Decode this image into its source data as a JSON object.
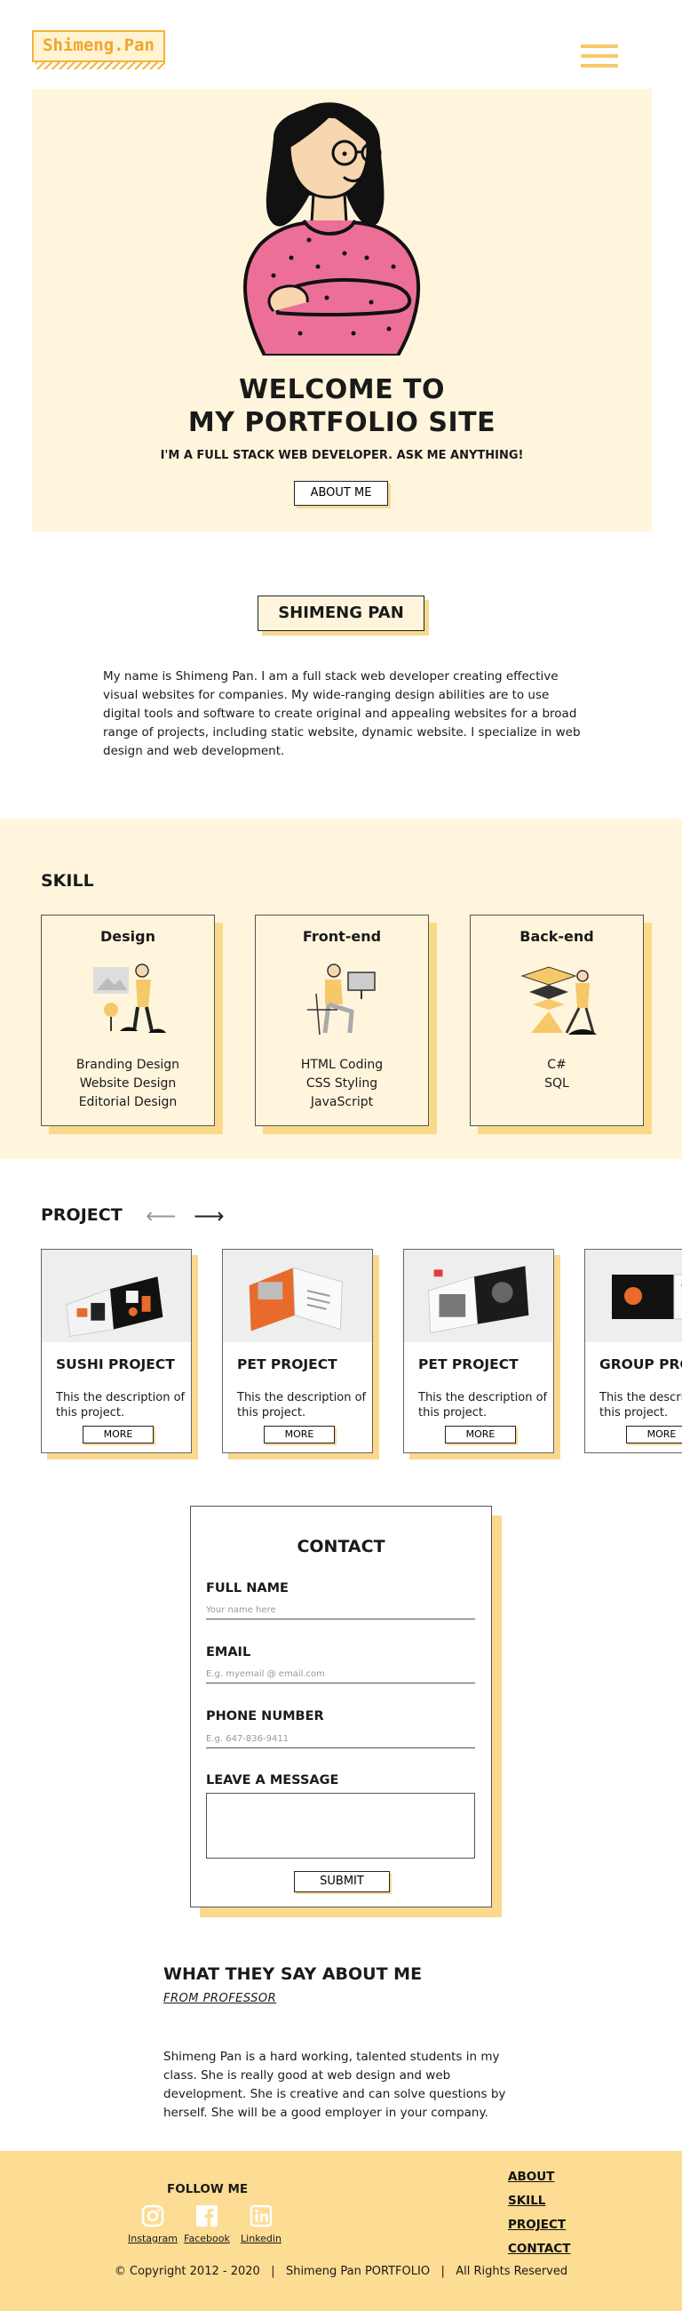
{
  "header": {
    "logo_text": "Shimeng.Pan",
    "menu_icon": "hamburger-icon"
  },
  "hero": {
    "title_line1": "WELCOME TO",
    "title_line2": "MY  PORTFOLIO SITE",
    "subtitle": "I'M A FULL STACK WEB DEVELOPER. ASK ME ANYTHING!",
    "button_label": "ABOUT ME"
  },
  "about": {
    "name": "SHIMENG PAN",
    "bio": "My name is Shimeng Pan. I am a full stack web developer creating effective visual websites for companies. My wide-ranging design abilities are to use digital tools and software to create original and appealing websites for a broad range of projects, including static website, dynamic website. I specialize in web design and web development."
  },
  "skill": {
    "title": "SKILL",
    "cards": [
      {
        "title": "Design",
        "items": [
          "Branding Design",
          "Website Design",
          "Editorial Design"
        ]
      },
      {
        "title": "Front-end",
        "items": [
          "HTML Coding",
          "CSS Styling",
          "JavaScript"
        ]
      },
      {
        "title": "Back-end",
        "items": [
          "C#",
          "SQL"
        ]
      }
    ]
  },
  "project": {
    "title": "PROJECT",
    "prev_icon": "arrow-left-icon",
    "next_icon": "arrow-right-icon",
    "cards": [
      {
        "title": "SUSHI PROJECT",
        "description": "This the description of this project.",
        "button": "MORE"
      },
      {
        "title": "PET PROJECT",
        "description": "This the description of this project.",
        "button": "MORE"
      },
      {
        "title": "PET PROJECT",
        "description": "This the description of this project.",
        "button": "MORE"
      },
      {
        "title": "GROUP PROJECT",
        "description": "This the description of this project.",
        "button": "MORE"
      }
    ]
  },
  "contact": {
    "title": "CONTACT",
    "full_name_label": "FULL NAME",
    "full_name_placeholder": "Your name here",
    "email_label": "EMAIL",
    "email_placeholder": "E.g. myemail @ email.com",
    "phone_label": "PHONE NUMBER",
    "phone_placeholder": "E.g. 647-836-9411",
    "message_label": "LEAVE A MESSAGE",
    "submit_label": "SUBMIT"
  },
  "testimonial": {
    "title": "WHAT THEY SAY ABOUT ME",
    "from": "FROM  PROFESSOR",
    "body": "Shimeng Pan is a hard working, talented students in my class. She is really good at web design and web development. She is creative and can solve questions by herself. She will be a good employer in your company."
  },
  "footer": {
    "follow_label": "FOLLOW ME",
    "social": [
      {
        "label": "Instagram",
        "icon": "instagram-icon"
      },
      {
        "label": "Facebook",
        "icon": "facebook-icon"
      },
      {
        "label": "Linkedin",
        "icon": "linkedin-icon"
      }
    ],
    "links": [
      "ABOUT",
      "SKILL",
      "PROJECT",
      "CONTACT"
    ],
    "copyright": "© Copyright 2012 - 2020   |   Shimeng Pan PORTFOLIO   |   All Rights Reserved"
  },
  "colors": {
    "accent": "#f5b43a",
    "cream": "#fff5dc",
    "shadow": "#fbd98c",
    "footer": "#fddc93",
    "sweater": "#ec6f98"
  }
}
